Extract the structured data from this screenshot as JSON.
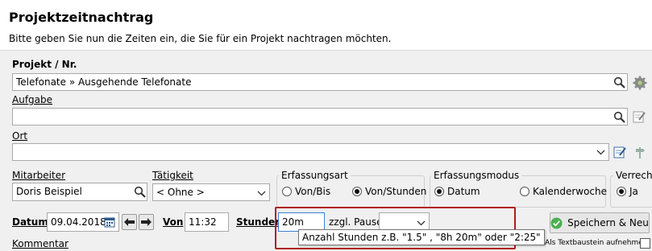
{
  "header": {
    "title": "Projektzeitnachtrag",
    "subtitle": "Bitte geben Sie nun die Zeiten ein, die Sie für ein Projekt nachtragen möchten."
  },
  "projekt": {
    "label": "Projekt / Nr.",
    "value": "Telefonate » Ausgehende Telefonate"
  },
  "aufgabe": {
    "label": "Aufgabe",
    "value": ""
  },
  "ort": {
    "label": "Ort",
    "value": ""
  },
  "mitarbeiter": {
    "label": "Mitarbeiter",
    "value": "Doris Beispiel"
  },
  "taetigkeit": {
    "label": "Tätigkeit",
    "value": "< Ohne >"
  },
  "erfassungsart": {
    "label": "Erfassungsart",
    "options": [
      "Von/Bis",
      "Von/Stunden"
    ],
    "selected": "Von/Stunden"
  },
  "erfassungsmodus": {
    "label": "Erfassungsmodus",
    "options": [
      "Datum",
      "Kalenderwoche"
    ],
    "selected": "Datum"
  },
  "verrechnen": {
    "label": "Verreche",
    "option": "Ja"
  },
  "datum": {
    "label": "Datum",
    "value": "09.04.2018"
  },
  "von": {
    "label": "Von",
    "value": "11:32"
  },
  "stunden": {
    "label": "Stunden",
    "value": "20m"
  },
  "pause": {
    "label": "zzgl. Pause",
    "value": ""
  },
  "tooltip": "Anzahl Stunden z.B. \"1.5\" , \"8h 20m\" oder \"2:25\"",
  "save_label": "Speichern & Neu",
  "textbaustein_label": "Als Textbaustein aufnehmen",
  "kommentar_label": "Kommentar",
  "colors": {
    "highlight": "#b01c1c",
    "save_icon": "#4caf50"
  }
}
